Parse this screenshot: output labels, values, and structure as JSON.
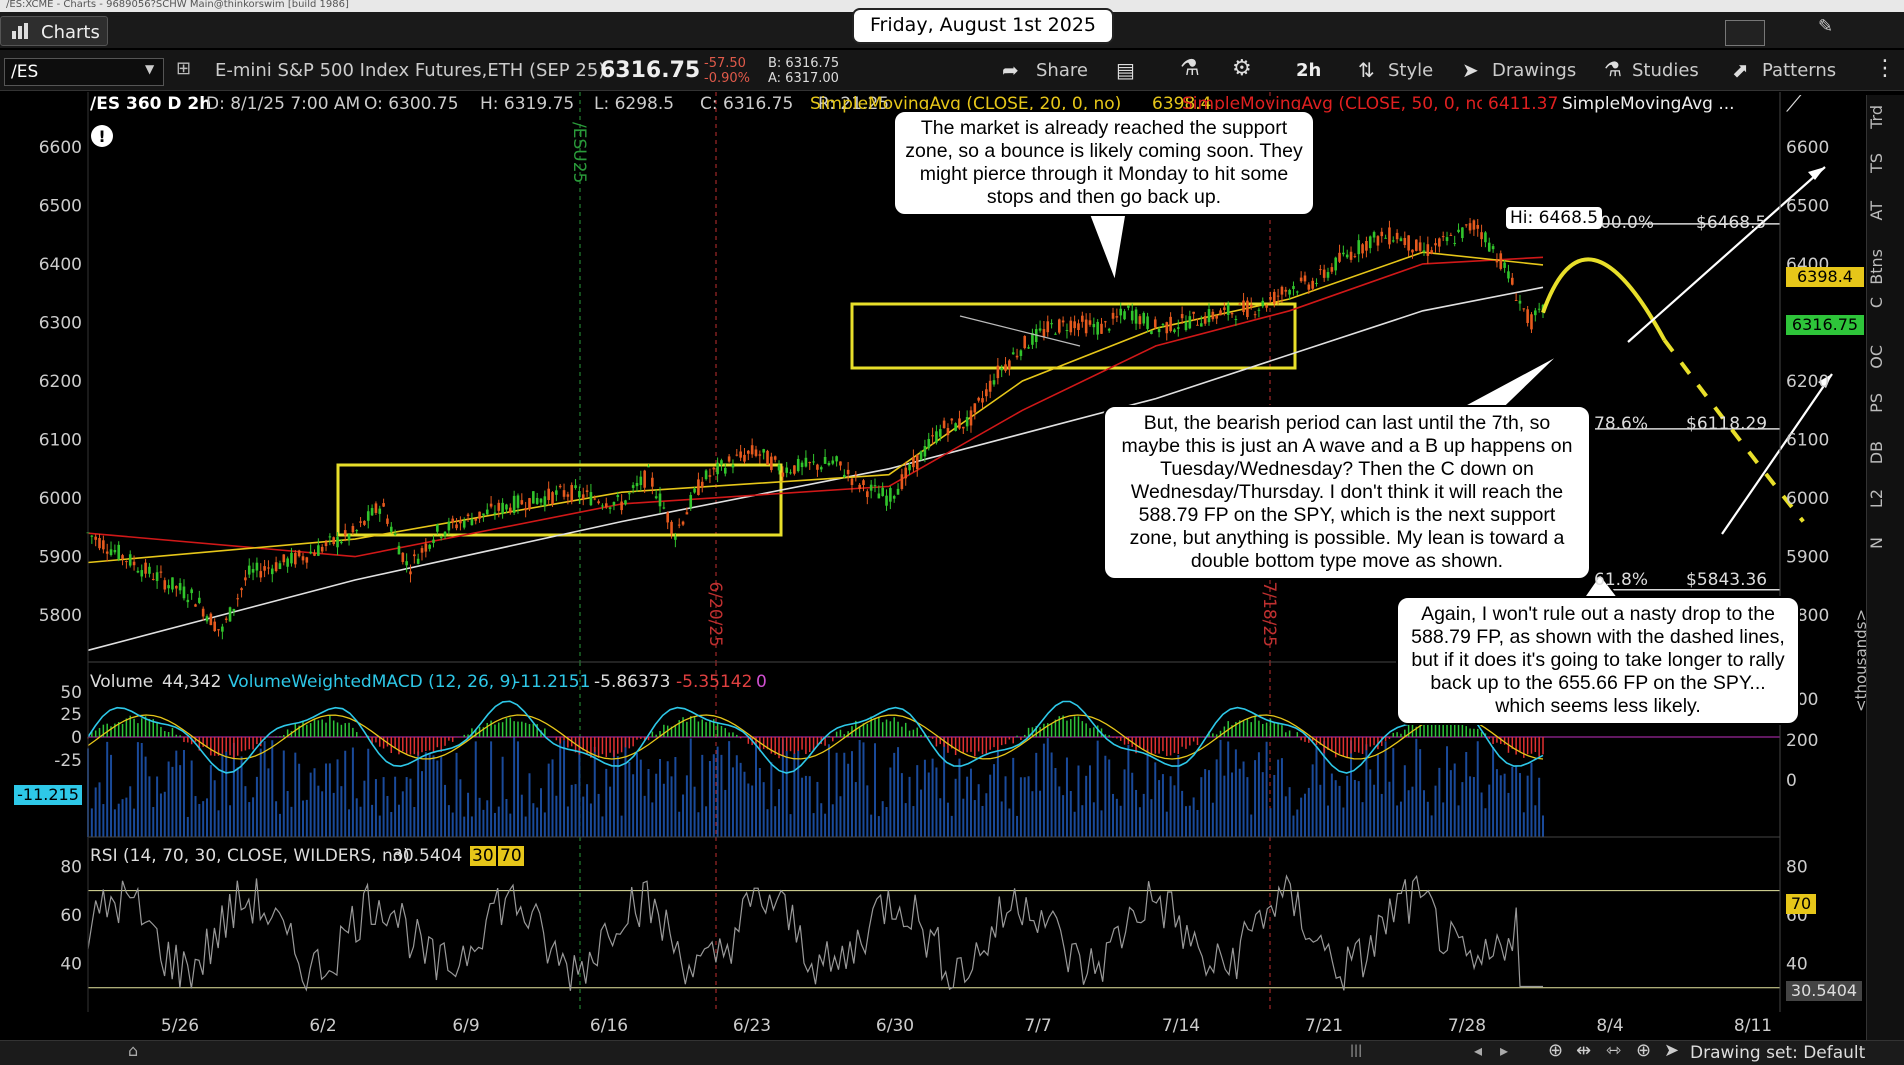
{
  "window_title": "/ES:XCME - Charts - 9689056?SCHW Main@thinkorswim [build 1986]",
  "tab_label": "Charts",
  "date_banner": "Friday, August 1st 2025",
  "toolbar": {
    "symbol": "/ES",
    "instrument_name": "E-mini S&P 500 Index Futures,ETH (SEP 25)",
    "last": "6316.75",
    "change": "-57.50",
    "change_pct": "-0.90%",
    "bid": "B: 6316.75",
    "ask": "A: 6317.00",
    "share": "Share",
    "timeframe": "2h",
    "style": "Style",
    "drawings": "Drawings",
    "studies": "Studies",
    "patterns": "Patterns"
  },
  "legend": {
    "chart_id": "/ES 360 D 2h",
    "date": "D: 8/1/25 7:00 AM",
    "open": "O: 6300.75",
    "high": "H: 6319.75",
    "low": "L: 6298.5",
    "close": "C: 6316.75",
    "range": "R: 21.25",
    "sma20": "SimpleMovingAvg (CLOSE, 20, 0, no)",
    "sma20_val": "6398.4",
    "sma50": "SimpleMovingAvg (CLOSE, 50, 0, no)",
    "sma50_val": "6411.37",
    "sma200": "SimpleMovingAvg ..."
  },
  "volume_legend": {
    "label": "Volume",
    "value": "44,342",
    "macd": "VolumeWeightedMACD (12, 26, 9)",
    "v1": "-11.2151",
    "v2": "-5.86373",
    "v3": "-5.35142",
    "v4": "0",
    "current_tag": "-11.215"
  },
  "rsi_legend": {
    "label": "RSI (14, 70, 30, CLOSE, WILDERS, no)",
    "value": "30.5404",
    "low": "30",
    "high": "70"
  },
  "price_tags": {
    "sma20": "6398.4",
    "last": "6316.75"
  },
  "fib_labels": [
    {
      "pct": "00.0%",
      "price": "$6468.5"
    },
    {
      "pct": "78.6%",
      "price": "$6118.29"
    },
    {
      "pct": "61.8%",
      "price": "$5843.36"
    }
  ],
  "hi_label": "Hi: 6468.5",
  "period_markers": [
    "/ESU25",
    "6/20/25",
    "7/18/25"
  ],
  "callouts": [
    "The market is already reached the support zone, so a bounce is likely coming soon. They might pierce through it Monday to hit some stops and then go back up.",
    "But, the bearish period can last until the 7th, so maybe this is just an A wave and a B up happens on Tuesday/Wednesday? Then the C down on Wednesday/Thursday.  I don't think it will reach the 588.79 FP on the SPY, which is the next support zone, but anything is possible.  My lean is toward a double bottom type move as shown.",
    "Again, I won't rule out a nasty drop to the 588.79 FP, as shown with the dashed lines, but if it does it's going to take longer to rally back up to the 655.66 FP on the SPY... which seems less likely."
  ],
  "sidebar_items": [
    "Trd",
    "TS",
    "AT",
    "Btns",
    "C",
    "OC",
    "PS",
    "DB",
    "L2",
    "N"
  ],
  "volume_axis_unit": "<thousands>",
  "status": {
    "drawing_set": "Drawing set: Default"
  },
  "chart_data": [
    {
      "type": "line",
      "title": "/ES 360 D 2h",
      "x_ticks": [
        "5/26",
        "6/2",
        "6/9",
        "6/16",
        "6/23",
        "6/30",
        "7/7",
        "7/14",
        "7/21",
        "7/28",
        "8/4",
        "8/11"
      ],
      "y_ticks": [
        5800,
        5900,
        6000,
        6100,
        6200,
        6300,
        6400,
        6500,
        6600
      ],
      "ylim": [
        5720,
        6680
      ],
      "series": [
        {
          "name": "/ES",
          "points": [
            [
              0,
              5940
            ],
            [
              2,
              5880
            ],
            [
              4,
              5830
            ],
            [
              5,
              5770
            ],
            [
              6,
              5870
            ],
            [
              8,
              5900
            ],
            [
              10,
              5940
            ],
            [
              11,
              5990
            ],
            [
              12,
              5880
            ],
            [
              13,
              5940
            ],
            [
              14,
              5960
            ],
            [
              16,
              5990
            ],
            [
              18,
              6010
            ],
            [
              20,
              5990
            ],
            [
              21,
              6040
            ],
            [
              22,
              5940
            ],
            [
              23,
              6030
            ],
            [
              24,
              6060
            ],
            [
              25,
              6080
            ],
            [
              26,
              6050
            ],
            [
              28,
              6060
            ],
            [
              29,
              6020
            ],
            [
              30,
              6000
            ],
            [
              31,
              6060
            ],
            [
              32,
              6120
            ],
            [
              33,
              6130
            ],
            [
              34,
              6210
            ],
            [
              35,
              6260
            ],
            [
              36,
              6290
            ],
            [
              37,
              6300
            ],
            [
              38,
              6290
            ],
            [
              39,
              6320
            ],
            [
              40,
              6290
            ],
            [
              41,
              6300
            ],
            [
              42,
              6310
            ],
            [
              43,
              6320
            ],
            [
              44,
              6330
            ],
            [
              45,
              6360
            ],
            [
              46,
              6370
            ],
            [
              47,
              6410
            ],
            [
              48,
              6440
            ],
            [
              49,
              6450
            ],
            [
              50,
              6420
            ],
            [
              51,
              6440
            ],
            [
              52,
              6468.5
            ],
            [
              53,
              6400
            ],
            [
              54,
              6300
            ],
            [
              54.5,
              6316.75
            ]
          ]
        },
        {
          "name": "SimpleMovingAvg (CLOSE, 20, 0, no)",
          "points": [
            [
              0,
              5890
            ],
            [
              10,
              5930
            ],
            [
              20,
              6010
            ],
            [
              30,
              6040
            ],
            [
              35,
              6200
            ],
            [
              40,
              6290
            ],
            [
              45,
              6340
            ],
            [
              50,
              6420
            ],
            [
              54.5,
              6398.4
            ]
          ]
        },
        {
          "name": "SimpleMovingAvg (CLOSE, 50, 0, no)",
          "points": [
            [
              0,
              5940
            ],
            [
              10,
              5900
            ],
            [
              20,
              5990
            ],
            [
              30,
              6020
            ],
            [
              35,
              6150
            ],
            [
              40,
              6260
            ],
            [
              45,
              6320
            ],
            [
              50,
              6400
            ],
            [
              54.5,
              6411.37
            ]
          ]
        },
        {
          "name": "SimpleMovingAvg ...",
          "points": [
            [
              0,
              5740
            ],
            [
              10,
              5860
            ],
            [
              20,
              5960
            ],
            [
              30,
              6050
            ],
            [
              40,
              6170
            ],
            [
              50,
              6320
            ],
            [
              54.5,
              6360
            ]
          ]
        }
      ],
      "fib_levels": [
        6468.5,
        6118.29,
        5843.36
      ],
      "projection": [
        [
          54.5,
          6316.75
        ],
        [
          56,
          6400
        ],
        [
          58,
          6270
        ],
        [
          60,
          6110
        ],
        [
          62,
          5960
        ],
        [
          64,
          6020
        ],
        [
          66,
          6240
        ]
      ]
    },
    {
      "type": "bar",
      "title": "Volume / VolumeWeightedMACD (12, 26, 9)",
      "y_ticks": [
        -25,
        0,
        25,
        50
      ],
      "volume_ticks": [
        0,
        200,
        400
      ],
      "current": -11.2151
    },
    {
      "type": "line",
      "title": "RSI (14, 70, 30, CLOSE, WILDERS, no)",
      "y_ticks": [
        40,
        60,
        80
      ],
      "levels": [
        30,
        70
      ],
      "current": 30.5404
    }
  ],
  "colors": {
    "up": "#31c42c",
    "down": "#e65a1e",
    "sma20": "#e6c619",
    "sma50": "#d01818",
    "sma200": "#e0e0e0",
    "box": "#e8df2a",
    "macd": "#2ec8e8",
    "fib": "#d9d9d9"
  }
}
